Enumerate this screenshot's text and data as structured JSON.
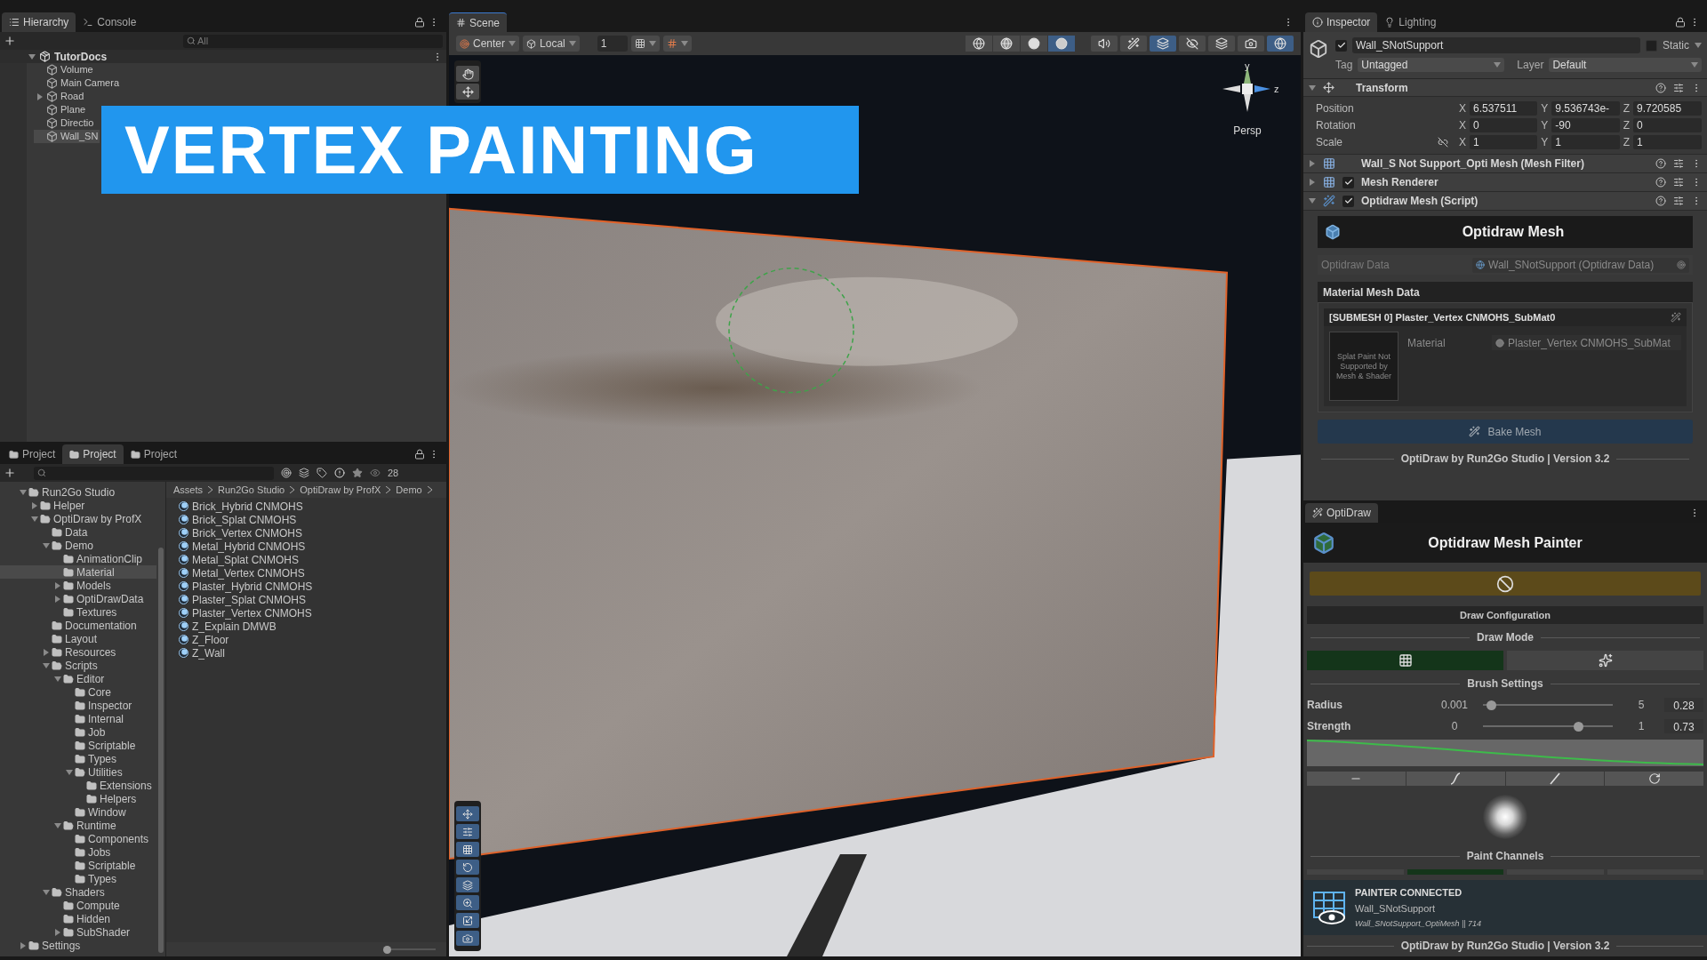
{
  "hierarchy": {
    "tabs": [
      {
        "label": "Hierarchy",
        "selected": true
      },
      {
        "label": "Console",
        "selected": false
      }
    ],
    "search": {
      "placeholder": "All"
    },
    "root": {
      "label": "TutorDocs",
      "expanded": true,
      "children": [
        {
          "label": "Volume",
          "selected": false
        },
        {
          "label": "Main Camera",
          "selected": false
        },
        {
          "label": "Road",
          "selected": false,
          "expanded": false
        },
        {
          "label": "Plane",
          "selected": false
        },
        {
          "label": "Directio",
          "selected": false
        },
        {
          "label": "Wall_SN",
          "selected": true
        }
      ]
    }
  },
  "overlay_title": "VERTEX PAINTING",
  "project": {
    "tabs": [
      {
        "label": "Project",
        "selected": false
      },
      {
        "label": "Project",
        "selected": true
      },
      {
        "label": "Project",
        "selected": false
      }
    ],
    "count": "28",
    "tree": [
      {
        "label": "Run2Go Studio",
        "expanded": true,
        "selected": false,
        "children": [
          {
            "label": "Helper",
            "expanded": false,
            "selected": false
          },
          {
            "label": "OptiDraw by ProfX",
            "expanded": true,
            "selected": false,
            "children": [
              {
                "label": "Data",
                "selected": false
              },
              {
                "label": "Demo",
                "expanded": true,
                "selected": false,
                "children": [
                  {
                    "label": "AnimationClip",
                    "selected": false
                  },
                  {
                    "label": "Material",
                    "selected": true
                  },
                  {
                    "label": "Models",
                    "expanded": false,
                    "selected": false
                  },
                  {
                    "label": "OptiDrawData",
                    "expanded": false,
                    "selected": false
                  },
                  {
                    "label": "Textures",
                    "selected": false
                  }
                ]
              },
              {
                "label": "Documentation",
                "selected": false
              },
              {
                "label": "Layout",
                "selected": false
              },
              {
                "label": "Resources",
                "expanded": false,
                "selected": false
              },
              {
                "label": "Scripts",
                "expanded": true,
                "selected": false,
                "children": [
                  {
                    "label": "Editor",
                    "expanded": true,
                    "selected": false,
                    "children": [
                      {
                        "label": "Core",
                        "selected": false
                      },
                      {
                        "label": "Inspector",
                        "selected": false
                      },
                      {
                        "label": "Internal",
                        "selected": false
                      },
                      {
                        "label": "Job",
                        "selected": false
                      },
                      {
                        "label": "Scriptable",
                        "selected": false
                      },
                      {
                        "label": "Types",
                        "selected": false
                      },
                      {
                        "label": "Utilities",
                        "expanded": true,
                        "selected": false,
                        "children": [
                          {
                            "label": "Extensions",
                            "selected": false
                          },
                          {
                            "label": "Helpers",
                            "selected": false
                          }
                        ]
                      },
                      {
                        "label": "Window",
                        "selected": false
                      }
                    ]
                  },
                  {
                    "label": "Runtime",
                    "expanded": true,
                    "selected": false,
                    "children": [
                      {
                        "label": "Components",
                        "selected": false
                      },
                      {
                        "label": "Jobs",
                        "selected": false
                      },
                      {
                        "label": "Scriptable",
                        "selected": false
                      },
                      {
                        "label": "Types",
                        "selected": false
                      }
                    ]
                  }
                ]
              },
              {
                "label": "Shaders",
                "expanded": true,
                "selected": false,
                "children": [
                  {
                    "label": "Compute",
                    "selected": false
                  },
                  {
                    "label": "Hidden",
                    "selected": false
                  },
                  {
                    "label": "SubShader",
                    "expanded": false,
                    "selected": false
                  }
                ]
              }
            ]
          }
        ]
      },
      {
        "label": "Settings",
        "expanded": false,
        "selected": false
      }
    ],
    "zoom": {
      "level": 0.05
    },
    "breadcrumb": [
      "Assets",
      "Run2Go Studio",
      "OptiDraw by ProfX",
      "Demo"
    ],
    "files": [
      "Brick_Hybrid CNMOHS",
      "Brick_Splat CNMOHS",
      "Brick_Vertex CNMOHS",
      "Metal_Hybrid CNMOHS",
      "Metal_Splat CNMOHS",
      "Metal_Vertex CNMOHS",
      "Plaster_Hybrid CNMOHS",
      "Plaster_Splat CNMOHS",
      "Plaster_Vertex CNMOHS",
      "Z_Explain DMWB",
      "Z_Floor",
      "Z_Wall"
    ]
  },
  "scene": {
    "tab": "Scene",
    "pivot": "Center",
    "space": "Local",
    "grid_size": "1",
    "shading_modes": [
      {
        "kind": "wireframe",
        "selected": false
      },
      {
        "kind": "shaded-wireframe",
        "selected": false
      },
      {
        "kind": "shaded",
        "selected": false
      },
      {
        "kind": "unlit",
        "selected": true
      }
    ],
    "toggles": [
      {
        "kind": "audio",
        "selected": false
      },
      {
        "kind": "fx",
        "selected": false
      },
      {
        "kind": "layers",
        "selected": true
      },
      {
        "kind": "visibility",
        "selected": false
      },
      {
        "kind": "stack",
        "selected": false
      },
      {
        "kind": "camera",
        "selected": false
      },
      {
        "kind": "gizmos",
        "selected": true
      }
    ],
    "gizmo": {
      "y": "y",
      "z": "z",
      "projection": "Persp"
    }
  },
  "inspector": {
    "tabs": [
      {
        "label": "Inspector",
        "selected": true
      },
      {
        "label": "Lighting",
        "selected": false
      }
    ],
    "object": {
      "name": "Wall_SNotSupport",
      "active": true,
      "static_label": "Static",
      "static": false,
      "tag_label": "Tag",
      "tag": "Untagged",
      "layer_label": "Layer",
      "layer": "Default"
    },
    "transform": {
      "title": "Transform",
      "expanded": true,
      "rows": [
        {
          "label": "Position",
          "fields": [
            {
              "axis": "X",
              "value": "6.537511"
            },
            {
              "axis": "Y",
              "value": "9.536743e-"
            },
            {
              "axis": "Z",
              "value": "9.720585"
            }
          ]
        },
        {
          "label": "Rotation",
          "fields": [
            {
              "axis": "X",
              "value": "0"
            },
            {
              "axis": "Y",
              "value": "-90"
            },
            {
              "axis": "Z",
              "value": "0"
            }
          ]
        },
        {
          "label": "Scale",
          "fields": [
            {
              "axis": "X",
              "value": "1"
            },
            {
              "axis": "Y",
              "value": "1"
            },
            {
              "axis": "Z",
              "value": "1"
            }
          ]
        }
      ]
    },
    "components": [
      {
        "kind": "mesh-filter",
        "title": "Wall_S Not Support_Opti Mesh (Mesh Filter)",
        "expanded": false
      },
      {
        "kind": "mesh-renderer",
        "title": "Mesh Renderer",
        "enabled": true,
        "expanded": false
      },
      {
        "kind": "script",
        "title": "Optidraw Mesh (Script)",
        "enabled": true,
        "expanded": true
      }
    ],
    "optidraw_mesh": {
      "title": "Optidraw Mesh",
      "data_label": "Optidraw Data",
      "data_value": "Wall_SNotSupport (Optidraw Data)",
      "section": "Material Mesh Data",
      "submesh": "[SUBMESH 0] Plaster_Vertex CNMOHS_SubMat0",
      "thumbnail_note": "Splat Paint Not Supported by Mesh & Shader",
      "material_label": "Material",
      "material_value": "Plaster_Vertex CNMOHS_SubMat",
      "bake": "Bake Mesh",
      "footer": "OptiDraw by Run2Go Studio | Version 3.2"
    }
  },
  "painter": {
    "tab": "OptiDraw",
    "title": "Optidraw Mesh Painter",
    "draw_config": "Draw Configuration",
    "draw_mode": "Draw Mode",
    "modes": [
      {
        "kind": "vertex",
        "selected": true
      },
      {
        "kind": "splat",
        "selected": false
      }
    ],
    "brush_settings": "Brush Settings",
    "sliders": [
      {
        "label": "Radius",
        "min": "0.001",
        "max": "5",
        "value": "0.28",
        "level": 0.06
      },
      {
        "label": "Strength",
        "min": "0",
        "max": "1",
        "value": "0.73",
        "level": 0.73
      }
    ],
    "curve_presets": [
      {
        "kind": "flat"
      },
      {
        "kind": "smooth"
      },
      {
        "kind": "linear"
      },
      {
        "kind": "reset"
      }
    ],
    "paint_channels": "Paint Channels",
    "channels": [
      {
        "selected": false
      },
      {
        "selected": true
      },
      {
        "selected": false
      },
      {
        "selected": false
      }
    ],
    "status": {
      "title": "PAINTER CONNECTED",
      "object": "Wall_SNotSupport",
      "mesh": "Wall_SNotSupport_OptiMesh || 714"
    },
    "footer": "OptiDraw by Run2Go Studio | Version 3.2"
  }
}
